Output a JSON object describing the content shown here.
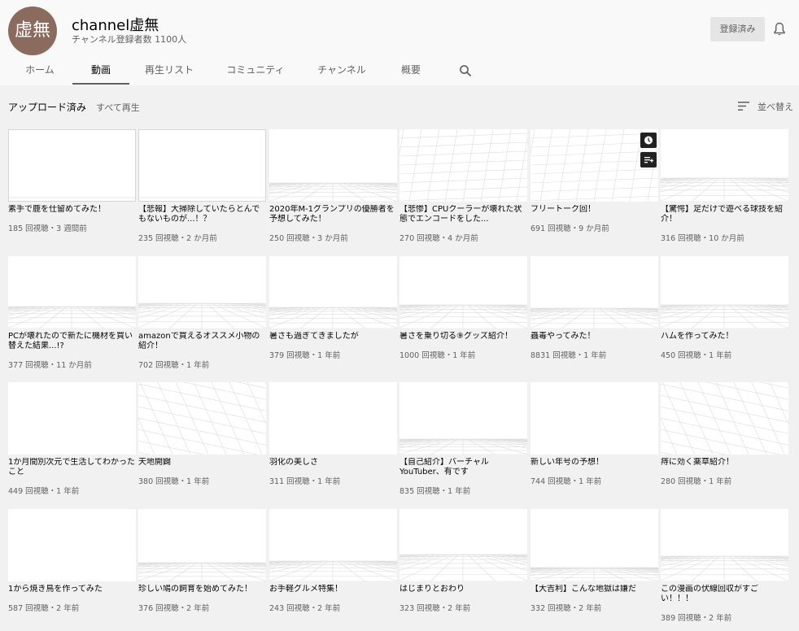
{
  "channel": {
    "avatar_text": "虚無",
    "name": "channel虚無",
    "subscribers": "チャンネル登録者数 1100人",
    "subscribed_label": "登録済み"
  },
  "tabs": [
    "ホーム",
    "動画",
    "再生リスト",
    "コミュニティ",
    "チャンネル",
    "概要"
  ],
  "active_tab": "動画",
  "section": {
    "title": "アップロード済み",
    "play_all": "すべて再生",
    "sort_label": "並べ替え"
  },
  "videos": [
    {
      "title": "素手で鹿を仕留めてみた！",
      "meta": "185 回視聴・3 週間前"
    },
    {
      "title": "【悲報】大掃除していたらとんでもないものが...！？",
      "meta": "235 回視聴・2 か月前"
    },
    {
      "title": "2020年M-1グランプリの優勝者を予想してみた！",
      "meta": "250 回視聴・3 か月前"
    },
    {
      "title": "【悲惨】CPUクーラーが壊れた状態でエンコードをした...",
      "meta": "270 回視聴・4 か月前"
    },
    {
      "title": "フリートーク回！",
      "meta": "691 回視聴・9 か月前"
    },
    {
      "title": "【驚愕】足だけで遊べる球技を紹介！",
      "meta": "316 回視聴・10 か月前"
    },
    {
      "title": "PCが壊れたので新たに機材を買い替えた結果...!?",
      "meta": "377 回視聴・11 か月前"
    },
    {
      "title": "amazonで買えるオススメ小物の紹介！",
      "meta": "702 回視聴・1 年前"
    },
    {
      "title": "暑さも過ぎてきましたが",
      "meta": "379 回視聴・1 年前"
    },
    {
      "title": "暑さを乗り切る⑨グッズ紹介！",
      "meta": "1000 回視聴・1 年前"
    },
    {
      "title": "蟲毒やってみた！",
      "meta": "8831 回視聴・1 年前"
    },
    {
      "title": "ハムを作ってみた！",
      "meta": "450 回視聴・1 年前"
    },
    {
      "title": "1か月間別次元で生活してわかったこと",
      "meta": "449 回視聴・1 年前"
    },
    {
      "title": "天地開闢",
      "meta": "380 回視聴・1 年前"
    },
    {
      "title": "羽化の美しさ",
      "meta": "311 回視聴・1 年前"
    },
    {
      "title": "【自己紹介】バーチャルYouTuber、有です",
      "meta": "835 回視聴・1 年前"
    },
    {
      "title": "新しい年号の予想！",
      "meta": "744 回視聴・1 年前"
    },
    {
      "title": "痔に効く薬草紹介！",
      "meta": "280 回視聴・1 年前"
    },
    {
      "title": "1から焼き鳥を作ってみた",
      "meta": "587 回視聴・2 年前"
    },
    {
      "title": "珍しい鳩の飼育を始めてみた！",
      "meta": "376 回視聴・2 年前"
    },
    {
      "title": "お手軽グルメ特集！",
      "meta": "243 回視聴・2 年前"
    },
    {
      "title": "はじまりとおわり",
      "meta": "323 回視聴・2 年前"
    },
    {
      "title": "【大吉利】こんな地獄は嫌だ",
      "meta": "332 回視聴・2 年前"
    },
    {
      "title": "この漫画の伏線回収がすごい！！！",
      "meta": "389 回視聴・2 年前"
    }
  ],
  "icons": {
    "bell": "bell-icon",
    "search": "search-icon",
    "sort": "sort-icon",
    "watch_later": "clock-icon",
    "add_to_queue": "queue-icon"
  }
}
